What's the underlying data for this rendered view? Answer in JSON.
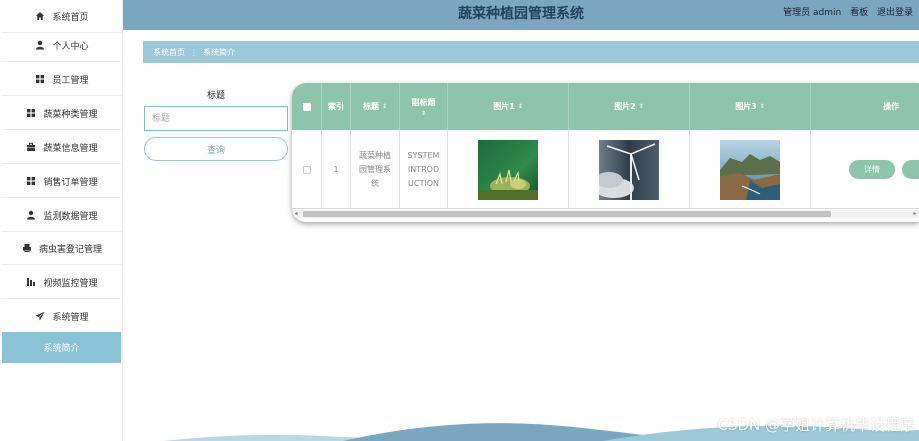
{
  "app": {
    "title": "蔬菜种植园管理系统"
  },
  "header": {
    "user": "管理员 admin",
    "board": "看板",
    "logout": "退出登录"
  },
  "sidebar": {
    "items": [
      {
        "label": "系统首页",
        "icon": "home-icon"
      },
      {
        "label": "个人中心",
        "icon": "user-icon"
      },
      {
        "label": "员工管理",
        "icon": "grid-icon"
      },
      {
        "label": "蔬菜种类管理",
        "icon": "grid-icon"
      },
      {
        "label": "蔬菜信息管理",
        "icon": "briefcase-icon"
      },
      {
        "label": "销售订单管理",
        "icon": "grid-icon"
      },
      {
        "label": "监测数据管理",
        "icon": "user-icon"
      },
      {
        "label": "病虫害登记管理",
        "icon": "printer-icon"
      },
      {
        "label": "视频监控管理",
        "icon": "bar-chart-icon"
      },
      {
        "label": "系统管理",
        "icon": "send-icon"
      },
      {
        "label": "系统简介",
        "icon": ""
      }
    ],
    "active_index": 10
  },
  "breadcrumb": {
    "home": "系统首页",
    "separator": "⋮",
    "current": "系统简介"
  },
  "search": {
    "label": "标题",
    "placeholder": "标题",
    "value": "",
    "button": "查询"
  },
  "table": {
    "columns": [
      "索引",
      "标题",
      "副标题",
      "图片1",
      "图片2",
      "图片3",
      "操作"
    ],
    "rows": [
      {
        "index": "1",
        "title": "蔬菜种植园管理系统",
        "subtitle": "SYSTEM INTRODUCTION",
        "images": [
          "moss-plant-image",
          "wind-turbine-image",
          "coastal-cliff-image"
        ],
        "action": "详情"
      }
    ]
  },
  "footer": {
    "watermark": "CSDN @学姐计算机毕设程序"
  },
  "colors": {
    "header": "#7aa7bf",
    "breadcrumb": "#9cc8d8",
    "table_header": "#8ec3ac",
    "active_side": "#8bc3d6"
  }
}
